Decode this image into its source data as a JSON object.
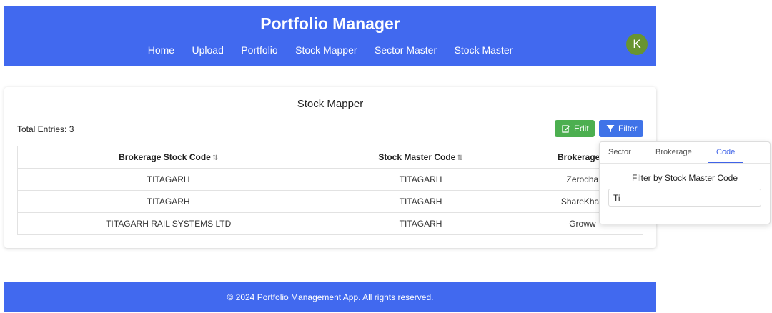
{
  "header": {
    "title": "Portfolio Manager",
    "nav": [
      "Home",
      "Upload",
      "Portfolio",
      "Stock Mapper",
      "Sector Master",
      "Stock Master"
    ],
    "avatar_initial": "K"
  },
  "main": {
    "title": "Stock Mapper",
    "total_entries": "Total Entries: 3",
    "edit_label": "Edit",
    "filter_label": "Filter",
    "table": {
      "headers": [
        "Brokerage Stock Code",
        "Stock Master Code",
        "Brokerage"
      ],
      "rows": [
        [
          "TITAGARH",
          "TITAGARH",
          "Zerodha"
        ],
        [
          "TITAGARH",
          "TITAGARH",
          "ShareKhan"
        ],
        [
          "TITAGARH RAIL SYSTEMS LTD",
          "TITAGARH",
          "Groww"
        ]
      ]
    }
  },
  "filter_popover": {
    "tabs": [
      "Sector",
      "Brokerage",
      "Code"
    ],
    "active_tab": "Code",
    "label": "Filter by Stock Master Code",
    "input_value": "Ti"
  },
  "footer": {
    "text": "© 2024 Portfolio Management App. All rights reserved."
  },
  "colors": {
    "brand": "#4169ef",
    "edit": "#4caf50",
    "filter": "#3f73e8",
    "avatar": "#689430"
  },
  "icons": {
    "edit": "edit-icon",
    "filter": "filter-icon",
    "sort": "sort-icon"
  }
}
